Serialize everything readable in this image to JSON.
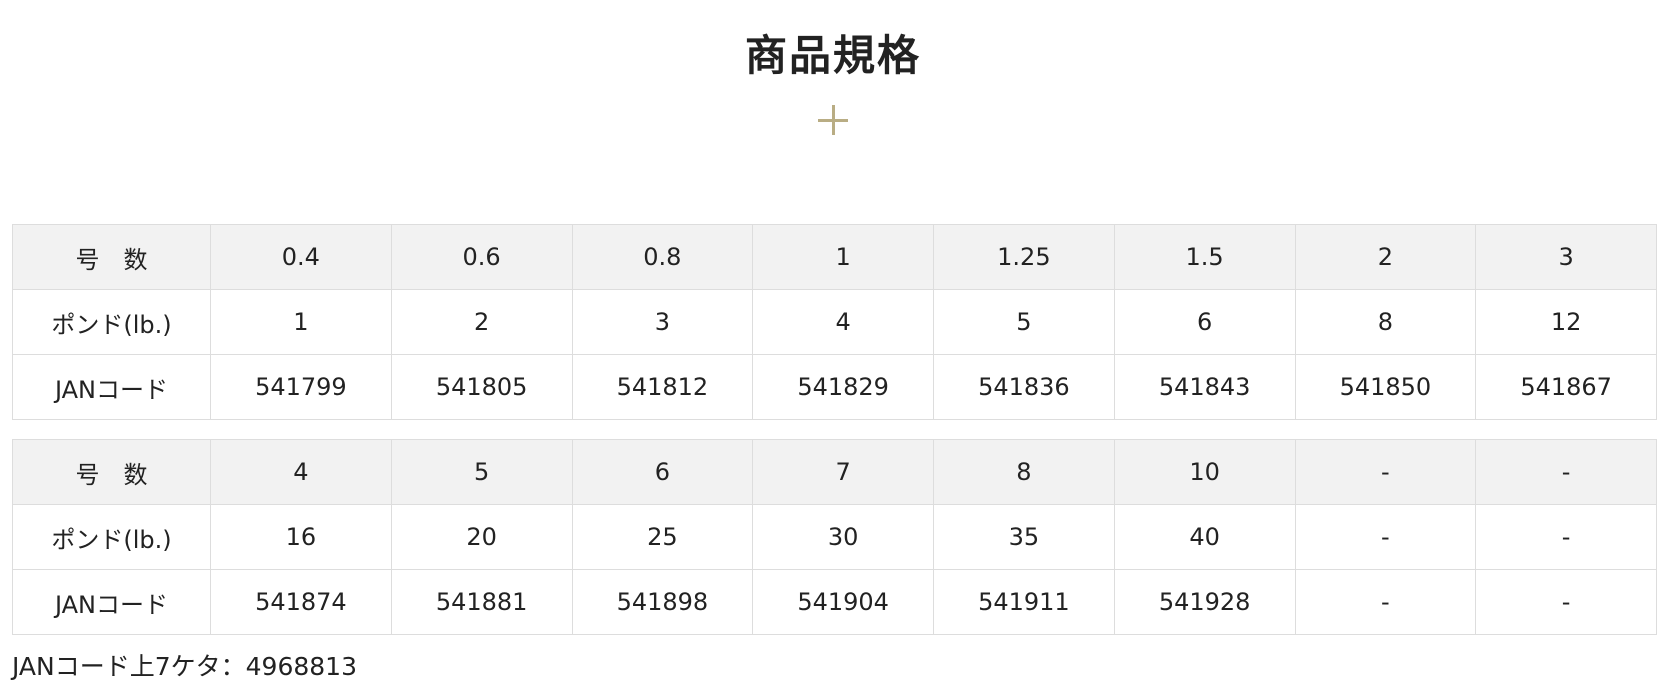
{
  "title": "商品規格",
  "tables": [
    {
      "rows": [
        {
          "label": "号　数",
          "values": [
            "0.4",
            "0.6",
            "0.8",
            "1",
            "1.25",
            "1.5",
            "2",
            "3"
          ]
        },
        {
          "label": "ポンド(lb.)",
          "values": [
            "1",
            "2",
            "3",
            "4",
            "5",
            "6",
            "8",
            "12"
          ]
        },
        {
          "label": "JANコード",
          "values": [
            "541799",
            "541805",
            "541812",
            "541829",
            "541836",
            "541843",
            "541850",
            "541867"
          ]
        }
      ]
    },
    {
      "rows": [
        {
          "label": "号　数",
          "values": [
            "4",
            "5",
            "6",
            "7",
            "8",
            "10",
            "-",
            "-"
          ]
        },
        {
          "label": "ポンド(lb.)",
          "values": [
            "16",
            "20",
            "25",
            "30",
            "35",
            "40",
            "-",
            "-"
          ]
        },
        {
          "label": "JANコード",
          "values": [
            "541874",
            "541881",
            "541898",
            "541904",
            "541911",
            "541928",
            "-",
            "-"
          ]
        }
      ]
    }
  ],
  "note": "JANコード上7ケタ：4968813",
  "colors": {
    "accent": "#b9ad84",
    "header_bg": "#f2f2f2",
    "border": "#dddddd",
    "text": "#222222"
  },
  "icons": {
    "divider": "plus-icon"
  }
}
